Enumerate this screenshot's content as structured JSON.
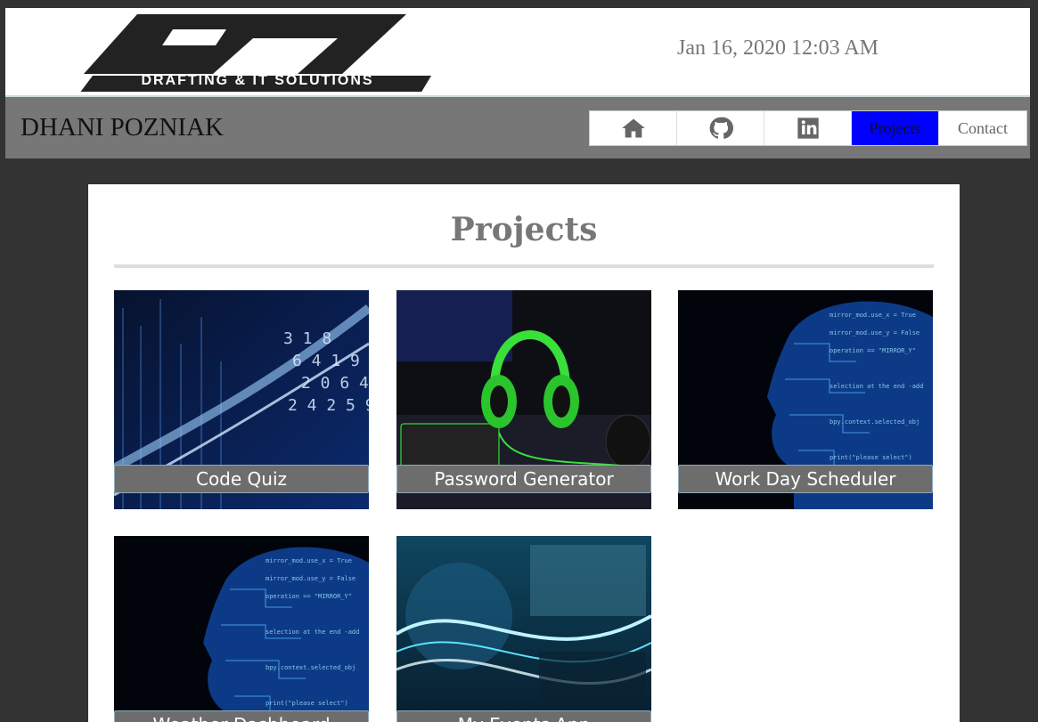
{
  "header": {
    "logo_text": "DRAFTING & IT SOLUTIONS",
    "datetime": "Jan 16, 2020 12:03 AM"
  },
  "navbar": {
    "brand": "DHANI POZNIAK",
    "items": [
      {
        "icon": "home-icon",
        "label": ""
      },
      {
        "icon": "github-icon",
        "label": ""
      },
      {
        "icon": "linkedin-icon",
        "label": ""
      },
      {
        "icon": "",
        "label": "Projects",
        "active": true
      },
      {
        "icon": "",
        "label": "Contact"
      }
    ],
    "active_color": "#0000ff"
  },
  "main": {
    "title": "Projects",
    "projects": [
      {
        "label": "Code Quiz",
        "art": "data-stream"
      },
      {
        "label": "Password Generator",
        "art": "green-headset"
      },
      {
        "label": "Work Day Scheduler",
        "art": "digital-head"
      },
      {
        "label": "Weather Dashboard",
        "art": "digital-head"
      },
      {
        "label": "My Events App",
        "art": "light-waves"
      }
    ]
  }
}
